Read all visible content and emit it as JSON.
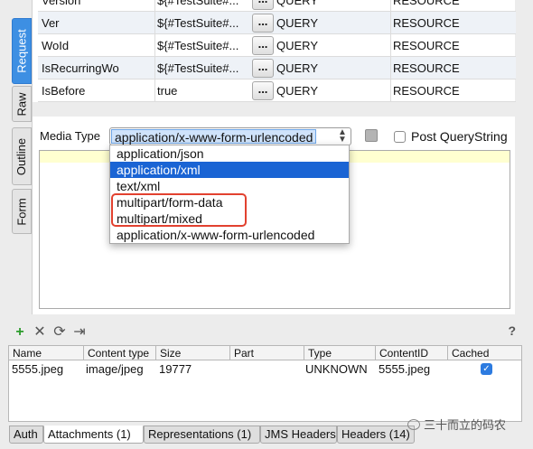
{
  "left_tabs": [
    {
      "label": "Request",
      "active": true
    },
    {
      "label": "Raw",
      "active": false
    },
    {
      "label": "Outline",
      "active": false
    },
    {
      "label": "Form",
      "active": false
    }
  ],
  "params": [
    {
      "name": "Version",
      "value": "${#TestSuite#...",
      "button": "...",
      "style": "QUERY",
      "level": "RESOURCE"
    },
    {
      "name": "Ver",
      "value": "${#TestSuite#...",
      "button": "...",
      "style": "QUERY",
      "level": "RESOURCE"
    },
    {
      "name": "WoId",
      "value": "${#TestSuite#...",
      "button": "...",
      "style": "QUERY",
      "level": "RESOURCE"
    },
    {
      "name": "IsRecurringWo",
      "value": "${#TestSuite#...",
      "button": "...",
      "style": "QUERY",
      "level": "RESOURCE"
    },
    {
      "name": "IsBefore",
      "value": "true",
      "button": "...",
      "style": "QUERY",
      "level": "RESOURCE"
    }
  ],
  "media_type": {
    "label": "Media Type",
    "selected": "application/x-www-form-urlencoded",
    "options": [
      "application/json",
      "application/xml",
      "text/xml",
      "multipart/form-data",
      "multipart/mixed",
      "application/x-www-form-urlencoded"
    ],
    "highlighted": "application/xml"
  },
  "post_querystring": {
    "label": "Post QueryString",
    "checked": false
  },
  "attachments_toolbar": {
    "add": "+",
    "remove": "✕",
    "reload": "⟳",
    "export": "⇥",
    "help": "?"
  },
  "attachments_table": {
    "headers": [
      "Name",
      "Content type",
      "Size",
      "Part",
      "Type",
      "ContentID",
      "Cached"
    ],
    "rows": [
      {
        "name": "5555.jpeg",
        "content_type": "image/jpeg",
        "size": "19777",
        "part": "",
        "type": "UNKNOWN",
        "content_id": "5555.jpeg",
        "cached": true
      }
    ]
  },
  "bottom_tabs": [
    {
      "label": "Auth",
      "active": false
    },
    {
      "label": "Attachments (1)",
      "active": true
    },
    {
      "label": "Representations (1)",
      "active": false
    },
    {
      "label": "JMS Headers",
      "active": false
    },
    {
      "label": "Headers (14)",
      "active": false
    }
  ],
  "watermark": "三十而立的码农",
  "colors": {
    "accent": "#1a64d4",
    "tab_active": "#3d8fe3",
    "annotation": "#e2412f",
    "editor_highlight": "#ffffd0"
  }
}
